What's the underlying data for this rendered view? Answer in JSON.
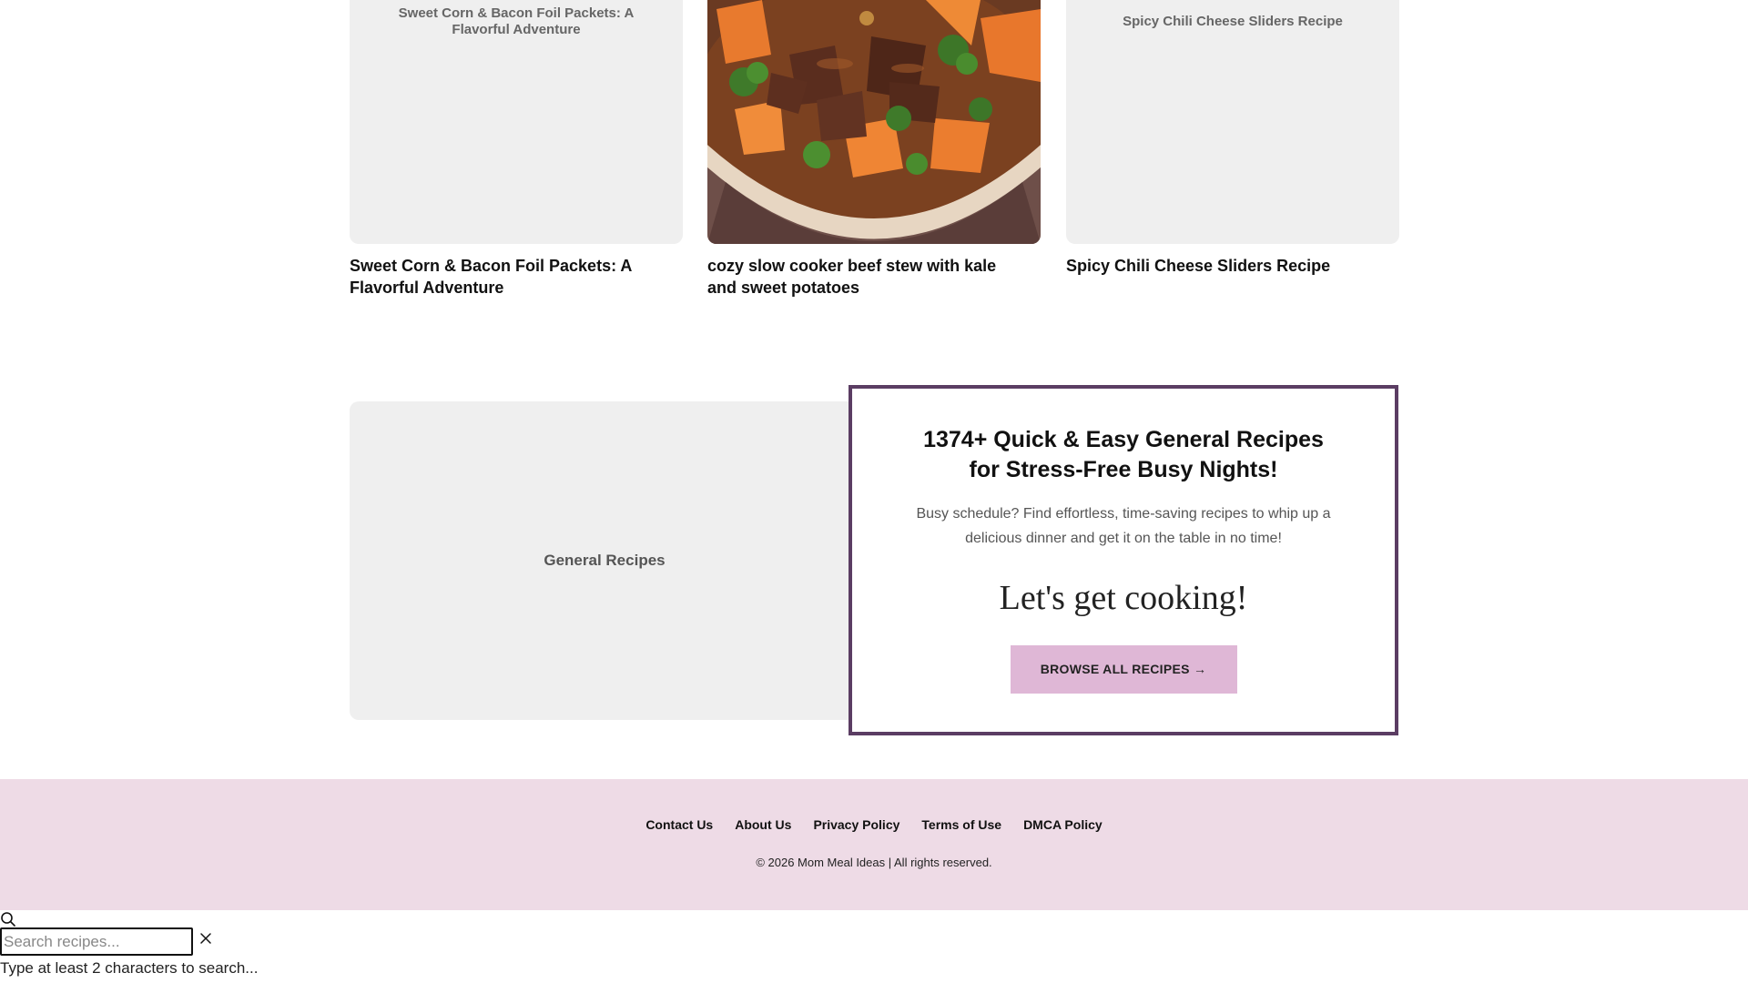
{
  "recipes": [
    {
      "placeholder": "Sweet Corn & Bacon Foil Packets: A Flavorful Adventure",
      "title": "Sweet Corn & Bacon Foil Packets: A Flavorful Adventure"
    },
    {
      "placeholder": "",
      "title": "cozy slow cooker beef stew with kale and sweet potatoes"
    },
    {
      "placeholder": "Spicy Chili Cheese Sliders Recipe",
      "title": "Spicy Chili Cheese Sliders Recipe"
    }
  ],
  "category": {
    "placeholder": "General Recipes",
    "title": "1374+ Quick & Easy General Recipes for Stress-Free Busy Nights!",
    "description": "Busy schedule? Find effortless, time-saving recipes to whip up a delicious dinner and get it on the table in no time!",
    "cta_heading": "Let's get cooking!",
    "button_label": "BROWSE ALL RECIPES →"
  },
  "footer": {
    "links": [
      "Contact Us",
      "About Us",
      "Privacy Policy",
      "Terms of Use",
      "DMCA Policy"
    ],
    "copyright": "© 2026 Mom Meal Ideas | All rights reserved."
  },
  "search": {
    "placeholder": "Search recipes...",
    "value": "",
    "hint": "Type at least 2 characters to search..."
  },
  "colors": {
    "accent_border": "#5b3d63",
    "button_bg": "#dfb7d6",
    "footer_bg": "#eedbe6",
    "placeholder_bg": "#efefef"
  },
  "icons": {
    "search": "search-icon",
    "close": "close-icon"
  }
}
